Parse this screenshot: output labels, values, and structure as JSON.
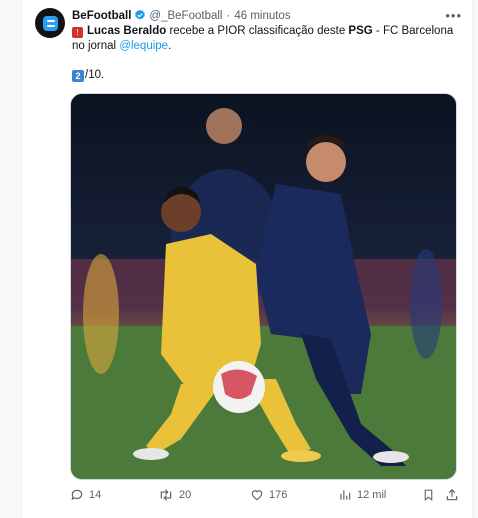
{
  "tweet": {
    "author_name": "BeFootball",
    "handle": "@_BeFootball",
    "separator": "·",
    "time": "46 minutos",
    "text_segments": [
      {
        "text": "Lucas Beraldo",
        "bold": true
      },
      {
        "text": " recebe a PIOR classificação deste "
      },
      {
        "text": "PSG",
        "bold": true
      },
      {
        "text": " - FC Barcelona no jornal "
      },
      {
        "text": "@lequipe",
        "mention": true
      },
      {
        "text": "."
      }
    ],
    "rating_keycap": "2",
    "rating_suffix": "/10."
  },
  "actions": {
    "replies": "14",
    "retweets": "20",
    "likes": "176",
    "views": "12 mil"
  },
  "colors": {
    "accent": "#1d9bf0",
    "verified": "#1d9bf0",
    "psg_kit": "#1b2a5c",
    "barca_kit": "#e9c23a"
  },
  "icons": [
    "befootball-logo",
    "verified-badge-icon",
    "more-icon",
    "siren-icon",
    "reply-icon",
    "retweet-icon",
    "like-icon",
    "views-icon",
    "bookmark-icon",
    "share-icon"
  ]
}
